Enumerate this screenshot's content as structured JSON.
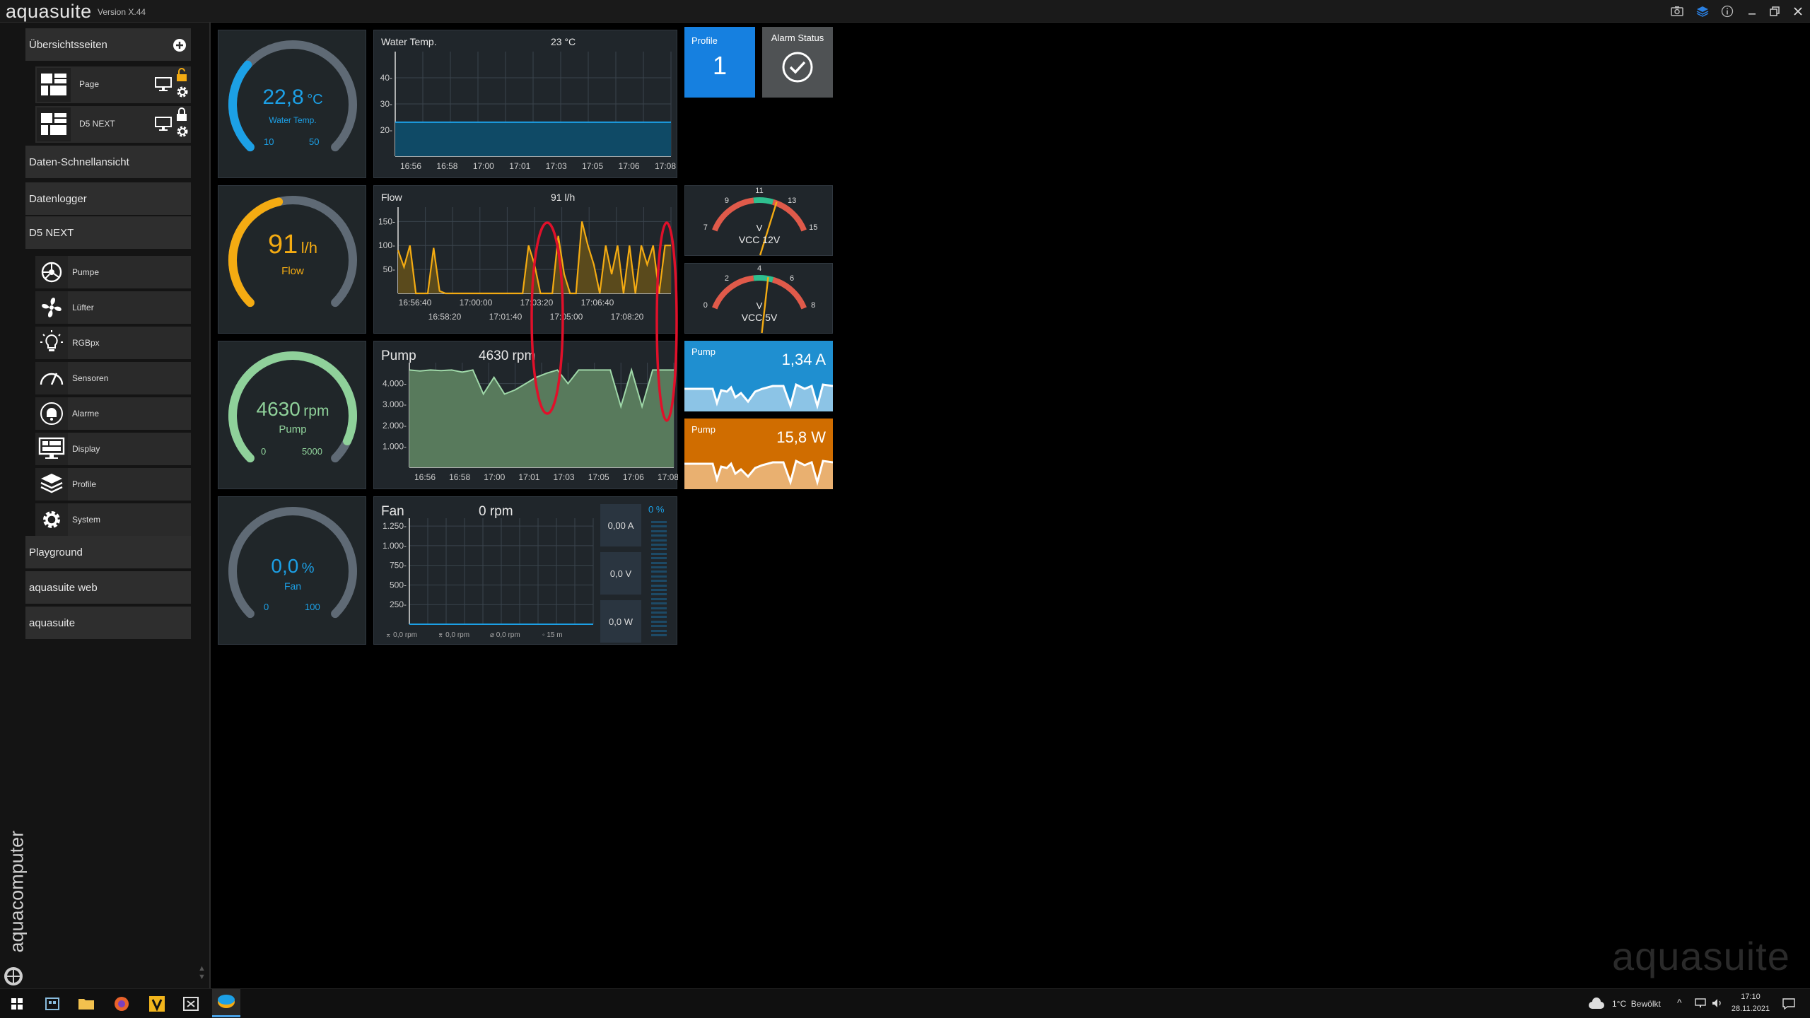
{
  "app": {
    "name": "aquasuite",
    "version": "Version X.44"
  },
  "sidebar": {
    "overview_title": "Übersichtsseiten",
    "pages": [
      {
        "label": "Page"
      },
      {
        "label": "D5 NEXT"
      }
    ],
    "quick_view": "Daten-Schnellansicht",
    "datalogger": "Datenlogger",
    "device": "D5 NEXT",
    "device_items": [
      {
        "label": "Pumpe",
        "icon": "pump-icon"
      },
      {
        "label": "Lüfter",
        "icon": "fan-icon"
      },
      {
        "label": "RGBpx",
        "icon": "lightbulb-icon"
      },
      {
        "label": "Sensoren",
        "icon": "sensor-gauge-icon"
      },
      {
        "label": "Alarme",
        "icon": "alarm-bell-icon"
      },
      {
        "label": "Display",
        "icon": "display-icon"
      },
      {
        "label": "Profile",
        "icon": "layers-icon"
      },
      {
        "label": "System",
        "icon": "gear-icon"
      }
    ],
    "playground": "Playground",
    "web": "aquasuite web",
    "aquasuite": "aquasuite",
    "brand": "aquacomputer"
  },
  "gauges": {
    "water": {
      "value": "22,8",
      "unit": "°C",
      "label": "Water Temp.",
      "min": "10",
      "max": "50",
      "fraction": 0.32,
      "color": "#1ca0e6"
    },
    "flow": {
      "value": "91",
      "unit": "l/h",
      "label": "Flow",
      "fraction": 0.45,
      "color": "#f4ab12"
    },
    "pump": {
      "value": "4630",
      "unit": "rpm",
      "label": "Pump",
      "min": "0",
      "max": "5000",
      "fraction": 0.926,
      "color": "#8fd19a"
    },
    "fan": {
      "value": "0,0",
      "unit": "%",
      "label": "Fan",
      "min": "0",
      "max": "100",
      "fraction": 0.0,
      "color": "#1ca0e6"
    }
  },
  "charts": {
    "water": {
      "title": "Water Temp.",
      "value": "23 °C"
    },
    "flow": {
      "title": "Flow",
      "value": "91 l/h"
    },
    "pump": {
      "title": "Pump",
      "value": "4630 rpm"
    },
    "fan": {
      "title": "Fan",
      "value": "0 rpm",
      "legend": [
        "⌅ 0,0 rpm",
        "⌆ 0,0 rpm",
        "⌀ 0,0 rpm",
        "◦ 15 m"
      ],
      "readouts": [
        "0,00 A",
        "0,0 V",
        "0,0 W"
      ],
      "percent": "0 %"
    }
  },
  "chart_data": [
    {
      "type": "area",
      "title": "Water Temp.",
      "x": [
        "16:56",
        "16:58",
        "17:00",
        "17:01",
        "17:03",
        "17:05",
        "17:06",
        "17:08"
      ],
      "y_ticks": [
        "40-",
        "30-",
        "20-"
      ],
      "ylim": [
        10,
        50
      ],
      "series": [
        {
          "values": [
            23,
            23,
            23,
            23,
            23,
            23,
            23,
            23
          ]
        }
      ]
    },
    {
      "type": "area",
      "title": "Flow",
      "x_top": [
        "16:56:40",
        "17:00:00",
        "17:03:20",
        "17:06:40"
      ],
      "x_bottom": [
        "16:58:20",
        "17:01:40",
        "17:05:00",
        "17:08:20"
      ],
      "y_ticks": [
        "150-",
        "100-",
        "50-"
      ],
      "ylim": [
        0,
        180
      ],
      "series": [
        {
          "values": [
            90,
            55,
            100,
            0,
            0,
            0,
            95,
            5,
            0,
            0,
            0,
            0,
            0,
            0,
            0,
            0,
            0,
            0,
            0,
            0,
            0,
            0,
            100,
            60,
            0,
            0,
            0,
            120,
            40,
            0,
            0,
            150,
            100,
            60,
            0,
            100,
            40,
            100,
            0,
            100,
            0,
            100,
            60,
            100,
            0,
            100,
            100
          ]
        }
      ]
    },
    {
      "type": "area",
      "title": "Pump",
      "x": [
        "16:56",
        "16:58",
        "17:00",
        "17:01",
        "17:03",
        "17:05",
        "17:06",
        "17:08"
      ],
      "y_ticks": [
        "4.000-",
        "3.000-",
        "2.000-",
        "1.000-"
      ],
      "ylim": [
        0,
        5000
      ],
      "series": [
        {
          "values": [
            4650,
            4600,
            4650,
            4620,
            4650,
            4550,
            4650,
            3500,
            4300,
            3500,
            3700,
            4000,
            4300,
            4500,
            4650,
            4000,
            4650,
            4650,
            4650,
            4650,
            2900,
            4650,
            2900,
            4650,
            4650,
            4650
          ]
        }
      ]
    },
    {
      "type": "line",
      "title": "Fan",
      "y_ticks": [
        "1.250-",
        "1.000-",
        "750-",
        "500-",
        "250-"
      ],
      "ylim": [
        0,
        1350
      ],
      "series": [
        {
          "values": [
            0,
            0,
            0,
            0,
            0,
            0,
            0,
            0
          ]
        }
      ]
    }
  ],
  "profile_tile": {
    "label": "Profile",
    "value": "1"
  },
  "alarm_tile": {
    "label": "Alarm Status"
  },
  "voltmeters": [
    {
      "label": "VCC 12V",
      "unit": "V",
      "ticks": [
        "7",
        "9",
        "11",
        "13",
        "15"
      ],
      "min": 7,
      "max": 15,
      "value": 12.2
    },
    {
      "label": "VCC 5V",
      "unit": "V",
      "ticks": [
        "0",
        "2",
        "4",
        "6",
        "8"
      ],
      "min": 0,
      "max": 8,
      "value": 4.6
    }
  ],
  "mini_tiles": [
    {
      "label": "Pump",
      "value": "1,34 A",
      "color": "#1f8fd0"
    },
    {
      "label": "Pump",
      "value": "15,8 W",
      "color": "#e07a00"
    }
  ],
  "watermark": "aquasuite",
  "taskbar": {
    "weather": "1°C  Bewölkt",
    "time": "17:10",
    "date": "28.11.2021"
  }
}
